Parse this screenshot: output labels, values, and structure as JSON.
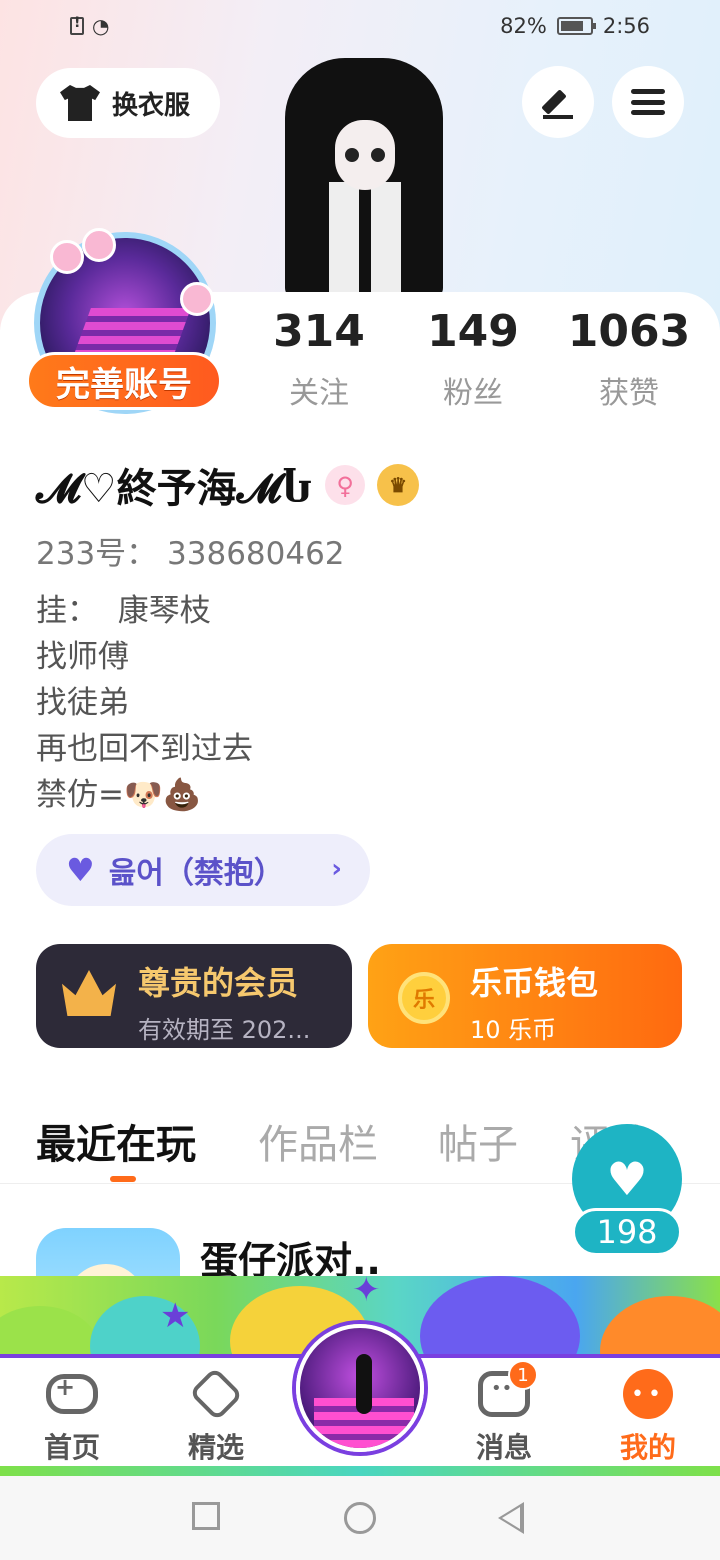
{
  "status_bar": {
    "battery_percent": "82%",
    "time": "2:56"
  },
  "header": {
    "outfit_button_label": "换衣服",
    "edit_icon": "pen-icon",
    "menu_icon": "hamburger-icon"
  },
  "profile": {
    "complete_account_label": "完善账号",
    "stats": [
      {
        "value": "314",
        "label": "关注"
      },
      {
        "value": "149",
        "label": "粉丝"
      },
      {
        "value": "1063",
        "label": "获赞"
      }
    ],
    "nickname": "𝓜♡終予海𝓜Ⴑ",
    "gender_symbol": "♀",
    "vip_symbol": "♛",
    "user_id": "233号： 338680462",
    "bio_lines": [
      "挂：  康琴枝",
      "找师傅",
      "找徒弟",
      "再也回不到过去",
      "禁仿=🐶💩"
    ],
    "tag_label": "읊어（禁抱）",
    "tag_chevron": "›"
  },
  "cards": {
    "vip": {
      "title": "尊贵的会员",
      "subtitle": "有效期至 202..."
    },
    "wallet": {
      "title": "乐币钱包",
      "subtitle": "10 乐币",
      "coin_glyph": "乐"
    }
  },
  "tabs": [
    "最近在玩",
    "作品栏",
    "帖子",
    "评论"
  ],
  "like_float": {
    "count": "198",
    "icon": "heart-icon"
  },
  "recent_game": {
    "title": "蛋仔派对.."
  },
  "bottom_nav": [
    {
      "label": "首页",
      "icon": "gamepad-icon"
    },
    {
      "label": "精选",
      "icon": "heart-tab-icon"
    },
    {
      "label": "消息",
      "icon": "chat-icon",
      "badge": "1"
    },
    {
      "label": "我的",
      "icon": "me-icon"
    }
  ],
  "colors": {
    "accent": "#ff6b1a",
    "teal": "#1eb4c4",
    "tag_purple": "#5b52c9",
    "vip_gold": "#f6c86e"
  }
}
